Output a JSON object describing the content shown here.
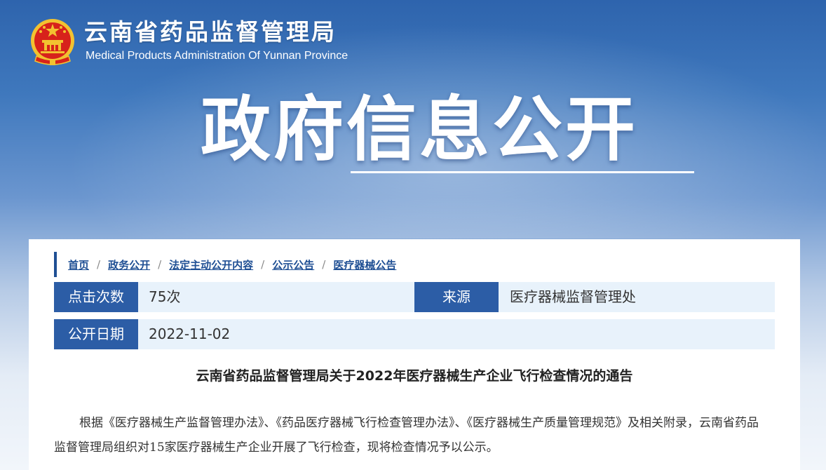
{
  "header": {
    "site_title": "云南省药品监督管理局",
    "site_subtitle": "Medical Products Administration Of Yunnan Province",
    "emblem_icon": "national-emblem-icon"
  },
  "banner": {
    "title": "政府信息公开"
  },
  "breadcrumb": [
    {
      "label": "首页"
    },
    {
      "label": "政务公开"
    },
    {
      "label": "法定主动公开内容"
    },
    {
      "label": "公示公告"
    },
    {
      "label": "医疗器械公告"
    }
  ],
  "breadcrumb_separator": "/",
  "info": {
    "clicks_label": "点击次数",
    "clicks_value": "75次",
    "source_label": "来源",
    "source_value": "医疗器械监督管理处",
    "date_label": "公开日期",
    "date_value": "2022-11-02"
  },
  "article": {
    "title": "云南省药品监督管理局关于2022年医疗器械生产企业飞行检查情况的通告",
    "paragraph": "根据《医疗器械生产监督管理办法》、《药品医疗器械飞行检查管理办法》、《医疗器械生产质量管理规范》及相关附录，云南省药品监督管理局组织对15家医疗器械生产企业开展了飞行检查，现将检查情况予以公示。"
  },
  "colors": {
    "primary": "#2c5da6",
    "link": "#1f4f94",
    "row_bg": "#e8f2fb",
    "emblem_red": "#d7221b",
    "emblem_gold": "#f2c230"
  }
}
